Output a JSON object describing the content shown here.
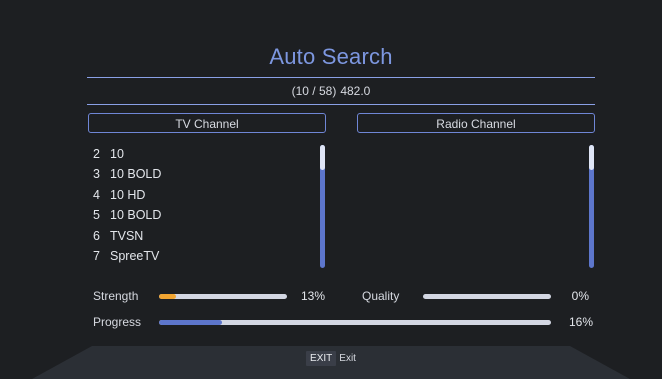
{
  "title": "Auto Search",
  "scan_info": {
    "progress_count": "(10 / 58)",
    "frequency": "482.0"
  },
  "tv_panel": {
    "header": "TV Channel",
    "channels": [
      {
        "number": "2",
        "name": "10"
      },
      {
        "number": "3",
        "name": "10 BOLD"
      },
      {
        "number": "4",
        "name": "10 HD"
      },
      {
        "number": "5",
        "name": "10 BOLD"
      },
      {
        "number": "6",
        "name": "TVSN"
      },
      {
        "number": "7",
        "name": "SpreeTV"
      }
    ]
  },
  "radio_panel": {
    "header": "Radio Channel",
    "channels": []
  },
  "meters": {
    "strength": {
      "label": "Strength",
      "value": 13,
      "text": "13%",
      "color": "#f2a531"
    },
    "quality": {
      "label": "Quality",
      "value": 0,
      "text": "0%",
      "color": "#5d76cc"
    },
    "progress": {
      "label": "Progress",
      "value": 16,
      "text": "16%",
      "color": "#5d76cc"
    }
  },
  "footer": {
    "key": "EXIT",
    "action": "Exit"
  },
  "colors": {
    "accent": "#7d97e0",
    "background": "#1d1f22",
    "track": "#d3d7e3",
    "scrollbar": "#5d76cc"
  }
}
